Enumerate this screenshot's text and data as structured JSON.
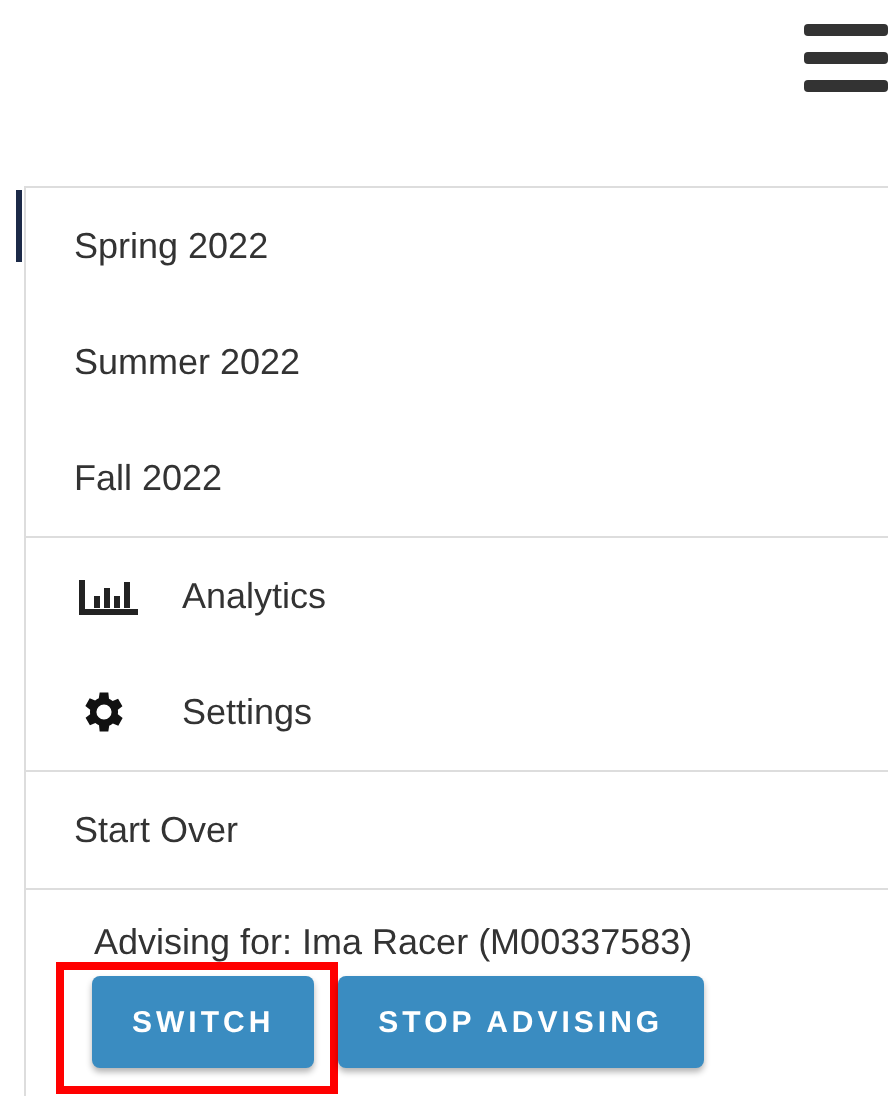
{
  "menu": {
    "terms": [
      {
        "label": "Spring 2022"
      },
      {
        "label": "Summer 2022"
      },
      {
        "label": "Fall 2022"
      }
    ],
    "links": [
      {
        "kind": "analytics",
        "label": "Analytics"
      },
      {
        "kind": "settings",
        "label": "Settings"
      }
    ],
    "start_over": "Start Over",
    "advising": {
      "text": "Advising for: Ima Racer (M00337583)",
      "buttons": [
        {
          "label": "SWITCH",
          "highlighted": true
        },
        {
          "label": "STOP ADVISING",
          "highlighted": false
        }
      ]
    }
  }
}
